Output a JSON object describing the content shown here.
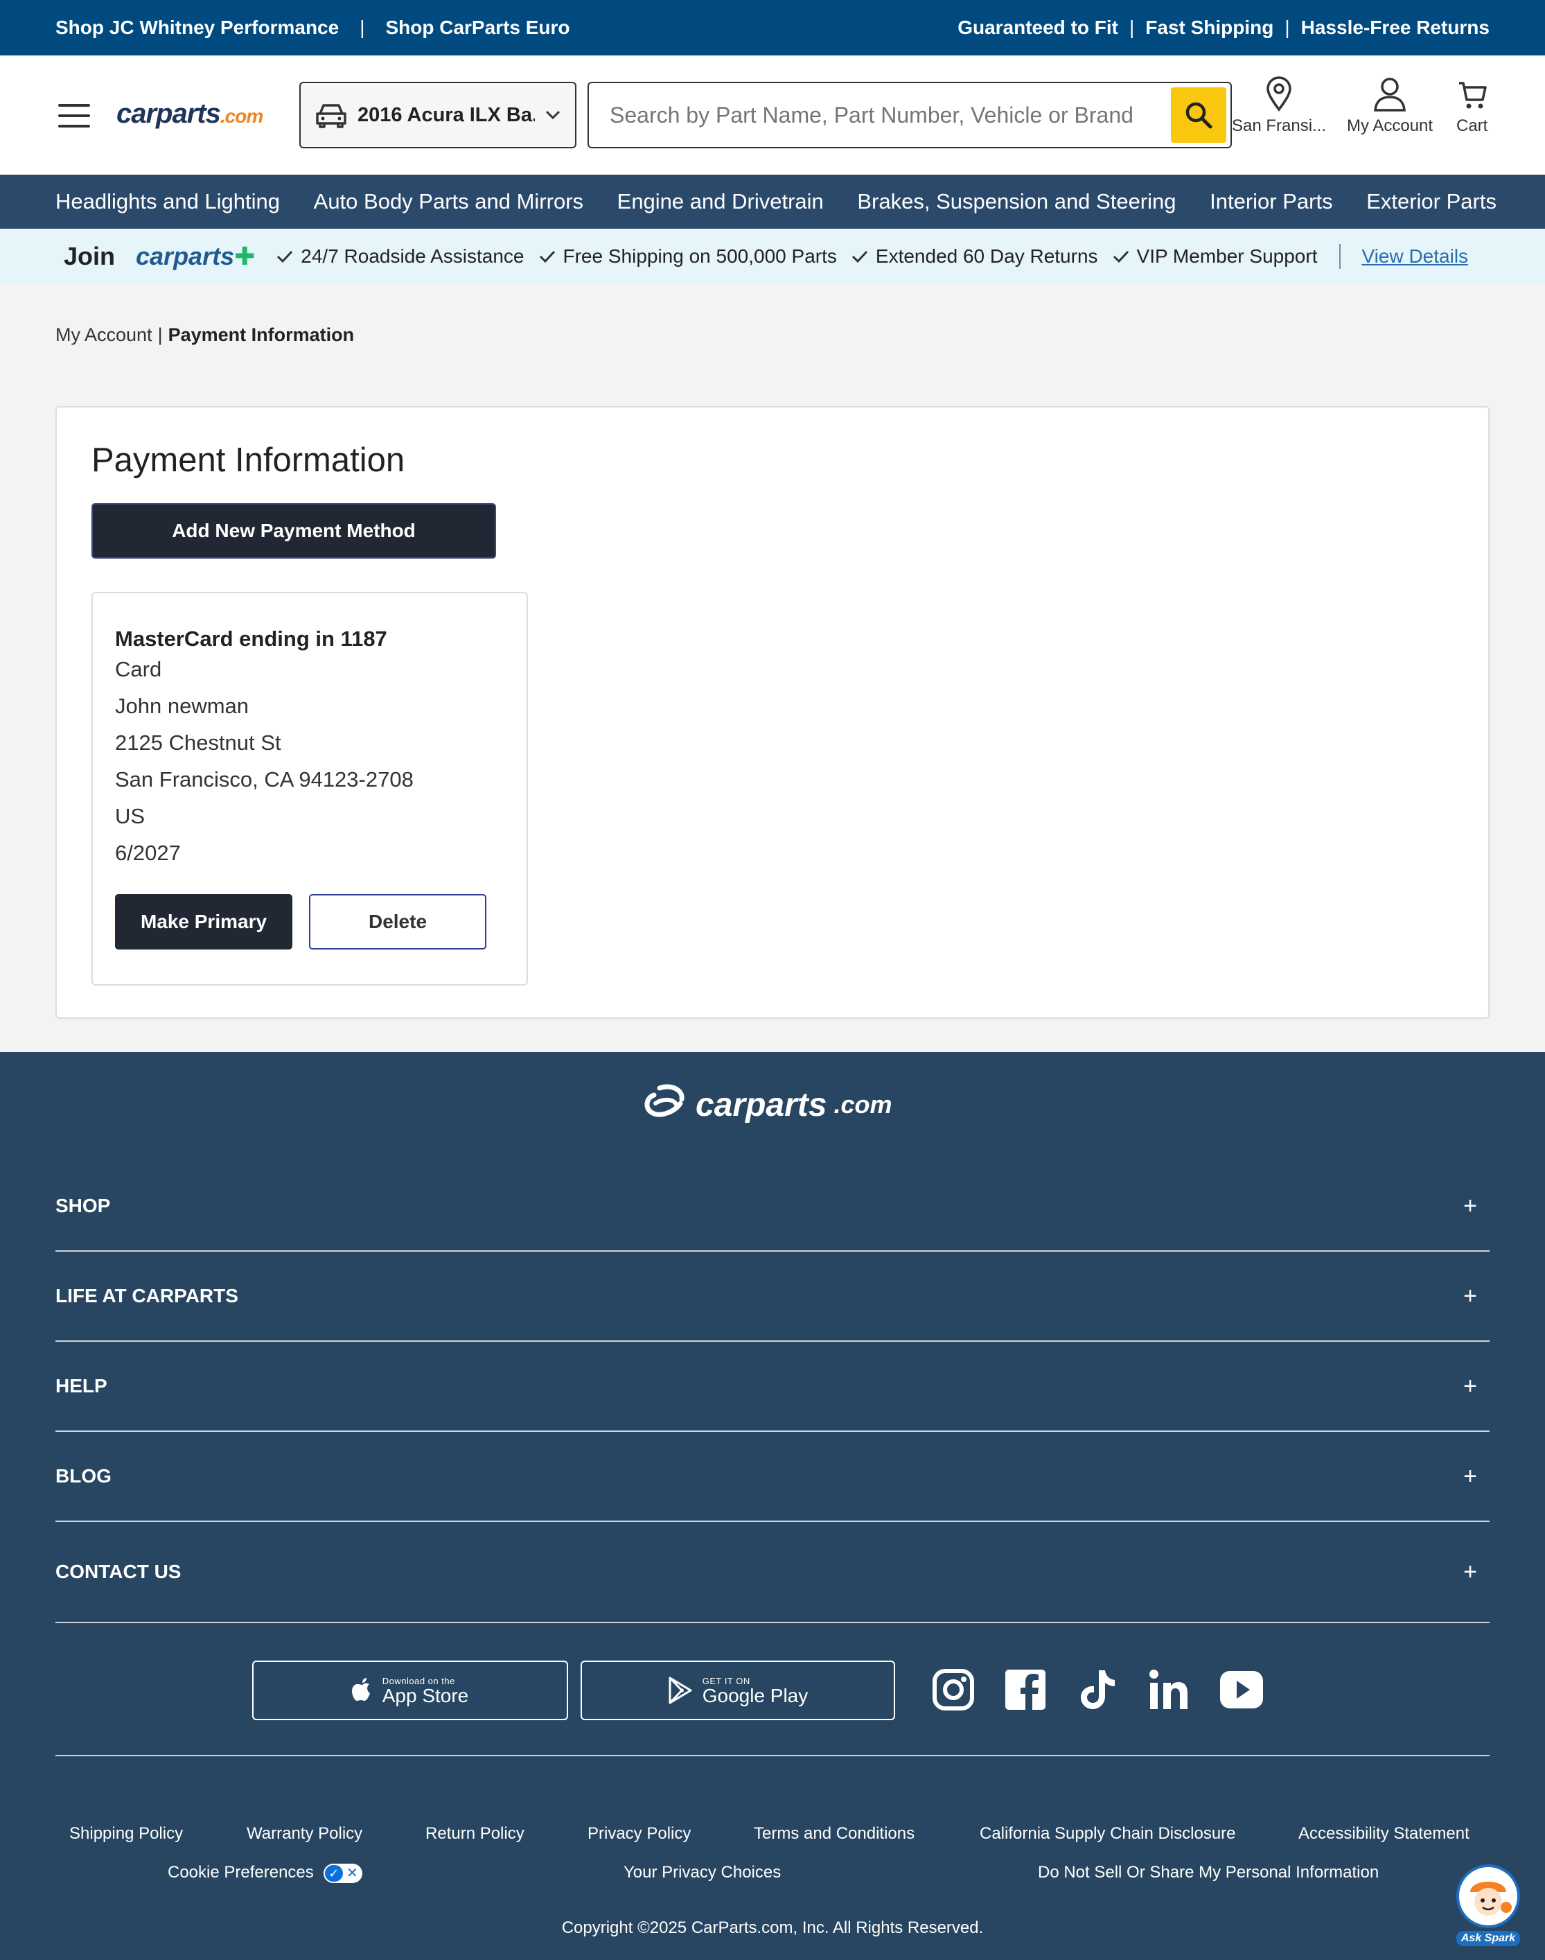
{
  "topbar": {
    "left_links": [
      "Shop JC Whitney Performance",
      "Shop CarParts Euro"
    ],
    "right_links": [
      "Guaranteed to Fit",
      "Fast Shipping",
      "Hassle-Free Returns"
    ]
  },
  "header": {
    "logo": "carparts",
    "logo_suffix": ".com",
    "vehicle": "2016 Acura ILX Ba...",
    "search_placeholder": "Search by Part Name, Part Number, Vehicle or Brand",
    "location_label": "San Fransi...",
    "account_label": "My Account",
    "cart_label": "Cart"
  },
  "nav": [
    "Headlights and Lighting",
    "Auto Body Parts and Mirrors",
    "Engine and Drivetrain",
    "Brakes, Suspension and Steering",
    "Interior Parts",
    "Exterior Parts"
  ],
  "membership": {
    "join": "Join",
    "brand": "carparts",
    "features": [
      "24/7 Roadside Assistance",
      "Free Shipping on 500,000 Parts",
      "Extended 60 Day Returns",
      "VIP Member Support"
    ],
    "details_link": "View Details"
  },
  "breadcrumb": {
    "parent": "My Account",
    "separator": "|",
    "current": "Payment Information"
  },
  "main": {
    "title": "Payment Information",
    "add_button": "Add New Payment Method",
    "payment_method": {
      "title": "MasterCard ending in 1187",
      "type": "Card",
      "name": "John newman",
      "address1": "2125 Chestnut St",
      "address2": "San Francisco, CA 94123-2708",
      "country": "US",
      "expiry": "6/2027",
      "primary_button": "Make Primary",
      "delete_button": "Delete"
    }
  },
  "footer": {
    "logo": "carparts",
    "logo_suffix": ".com",
    "sections": [
      "SHOP",
      "LIFE AT CARPARTS",
      "HELP",
      "BLOG",
      "CONTACT US"
    ],
    "app_store": {
      "small": "Download on the",
      "big": "App Store"
    },
    "google_play": {
      "small": "GET IT ON",
      "big": "Google Play"
    },
    "social_icons": [
      "instagram-icon",
      "facebook-icon",
      "tiktok-icon",
      "linkedin-icon",
      "youtube-icon"
    ],
    "policy_links": [
      "Shipping Policy",
      "Warranty Policy",
      "Return Policy",
      "Privacy Policy",
      "Terms and Conditions",
      "California Supply Chain Disclosure",
      "Accessibility Statement"
    ],
    "second_row": [
      "Cookie Preferences",
      "Your Privacy Choices",
      "Do Not Sell Or Share My Personal Information"
    ],
    "copyright": "Copyright ©2025 CarParts.com, Inc. All Rights Reserved.",
    "spark_label": "Ask Spark"
  },
  "colors": {
    "topbar": "#004a80",
    "nav": "#2b4a6b",
    "footer": "#284661",
    "search_button": "#f9c80e",
    "dark_button": "#222734",
    "membership_bg": "#e5f5fa",
    "accent_orange": "#f58220"
  }
}
